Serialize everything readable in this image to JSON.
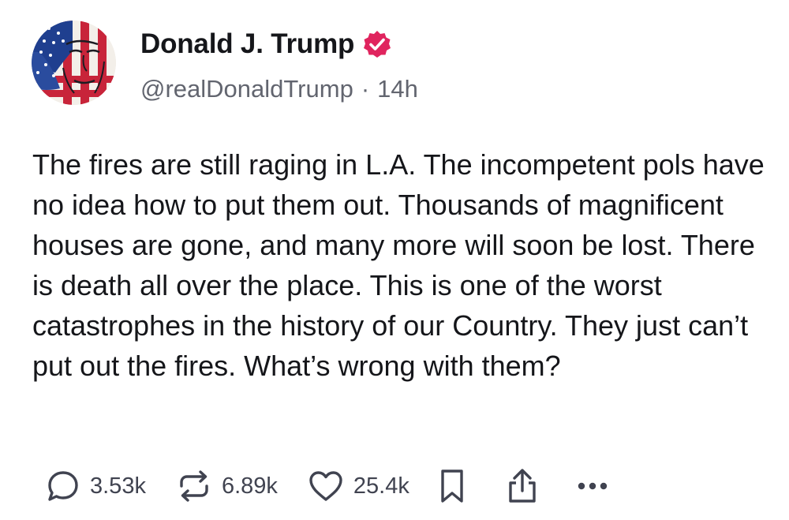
{
  "author": {
    "display_name": "Donald J. Trump",
    "handle": "@realDonaldTrump",
    "separator": "·",
    "time": "14h",
    "verified_icon": "verified-badge-icon",
    "avatar_icon": "flag-portrait-avatar"
  },
  "post": {
    "text": "The fires are still raging in L.A. The incompetent pols have no idea how to put them out. Thousands of magnificent houses are gone, and many more will soon be lost. There is death all over the place. This is one of the worst catastrophes in the history of our Country. They just can’t put out the fires. What’s wrong with them?"
  },
  "actions": {
    "replies": {
      "icon": "reply-bubble-icon",
      "count": "3.53k"
    },
    "retruths": {
      "icon": "repost-icon",
      "count": "6.89k"
    },
    "likes": {
      "icon": "heart-icon",
      "count": "25.4k"
    },
    "bookmark": {
      "icon": "bookmark-icon"
    },
    "share": {
      "icon": "share-icon"
    },
    "more": {
      "icon": "more-icon"
    }
  },
  "colors": {
    "verified": "#e0245e",
    "text": "#15161a",
    "muted": "#62656f",
    "icon": "#404350"
  }
}
